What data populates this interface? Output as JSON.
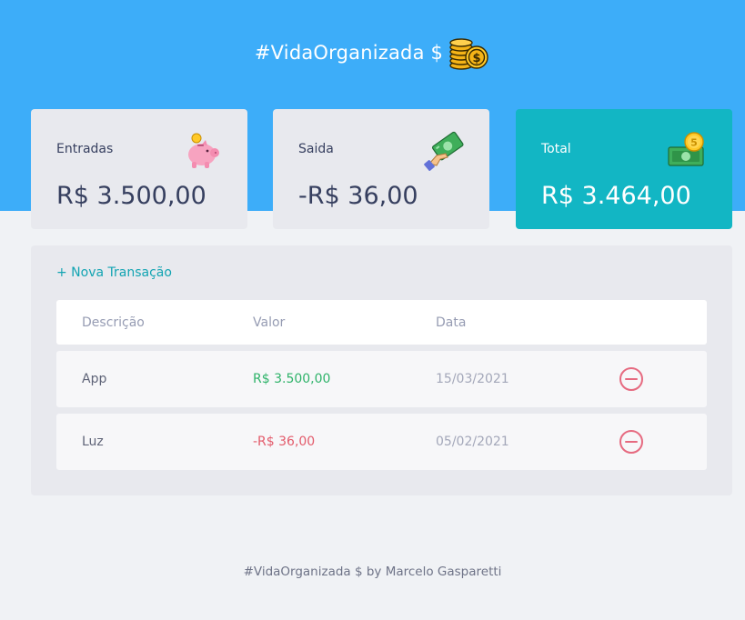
{
  "header": {
    "title": "#VidaOrganizada $",
    "icon": "coins-icon"
  },
  "cards": {
    "income": {
      "label": "Entradas",
      "value": "R$ 3.500,00",
      "icon": "piggy-bank-icon"
    },
    "expense": {
      "label": "Saida",
      "value": "-R$ 36,00",
      "icon": "money-hand-icon"
    },
    "total": {
      "label": "Total",
      "value": "R$ 3.464,00",
      "icon": "cash-coin-icon"
    }
  },
  "transactions": {
    "new_label": "+ Nova Transação",
    "columns": [
      "Descrição",
      "Valor",
      "Data"
    ],
    "rows": [
      {
        "description": "App",
        "amount": "R$ 3.500,00",
        "date": "15/03/2021",
        "type": "income"
      },
      {
        "description": "Luz",
        "amount": "-R$ 36,00",
        "date": "05/02/2021",
        "type": "expense"
      }
    ]
  },
  "footer": {
    "text": "#VidaOrganizada $ by Marcelo Gasparetti"
  },
  "colors": {
    "header_bg": "#3dadf9",
    "total_card": "#12b6c4",
    "income": "#2fb36a",
    "expense": "#e35b6b",
    "accent": "#12a4b2"
  }
}
